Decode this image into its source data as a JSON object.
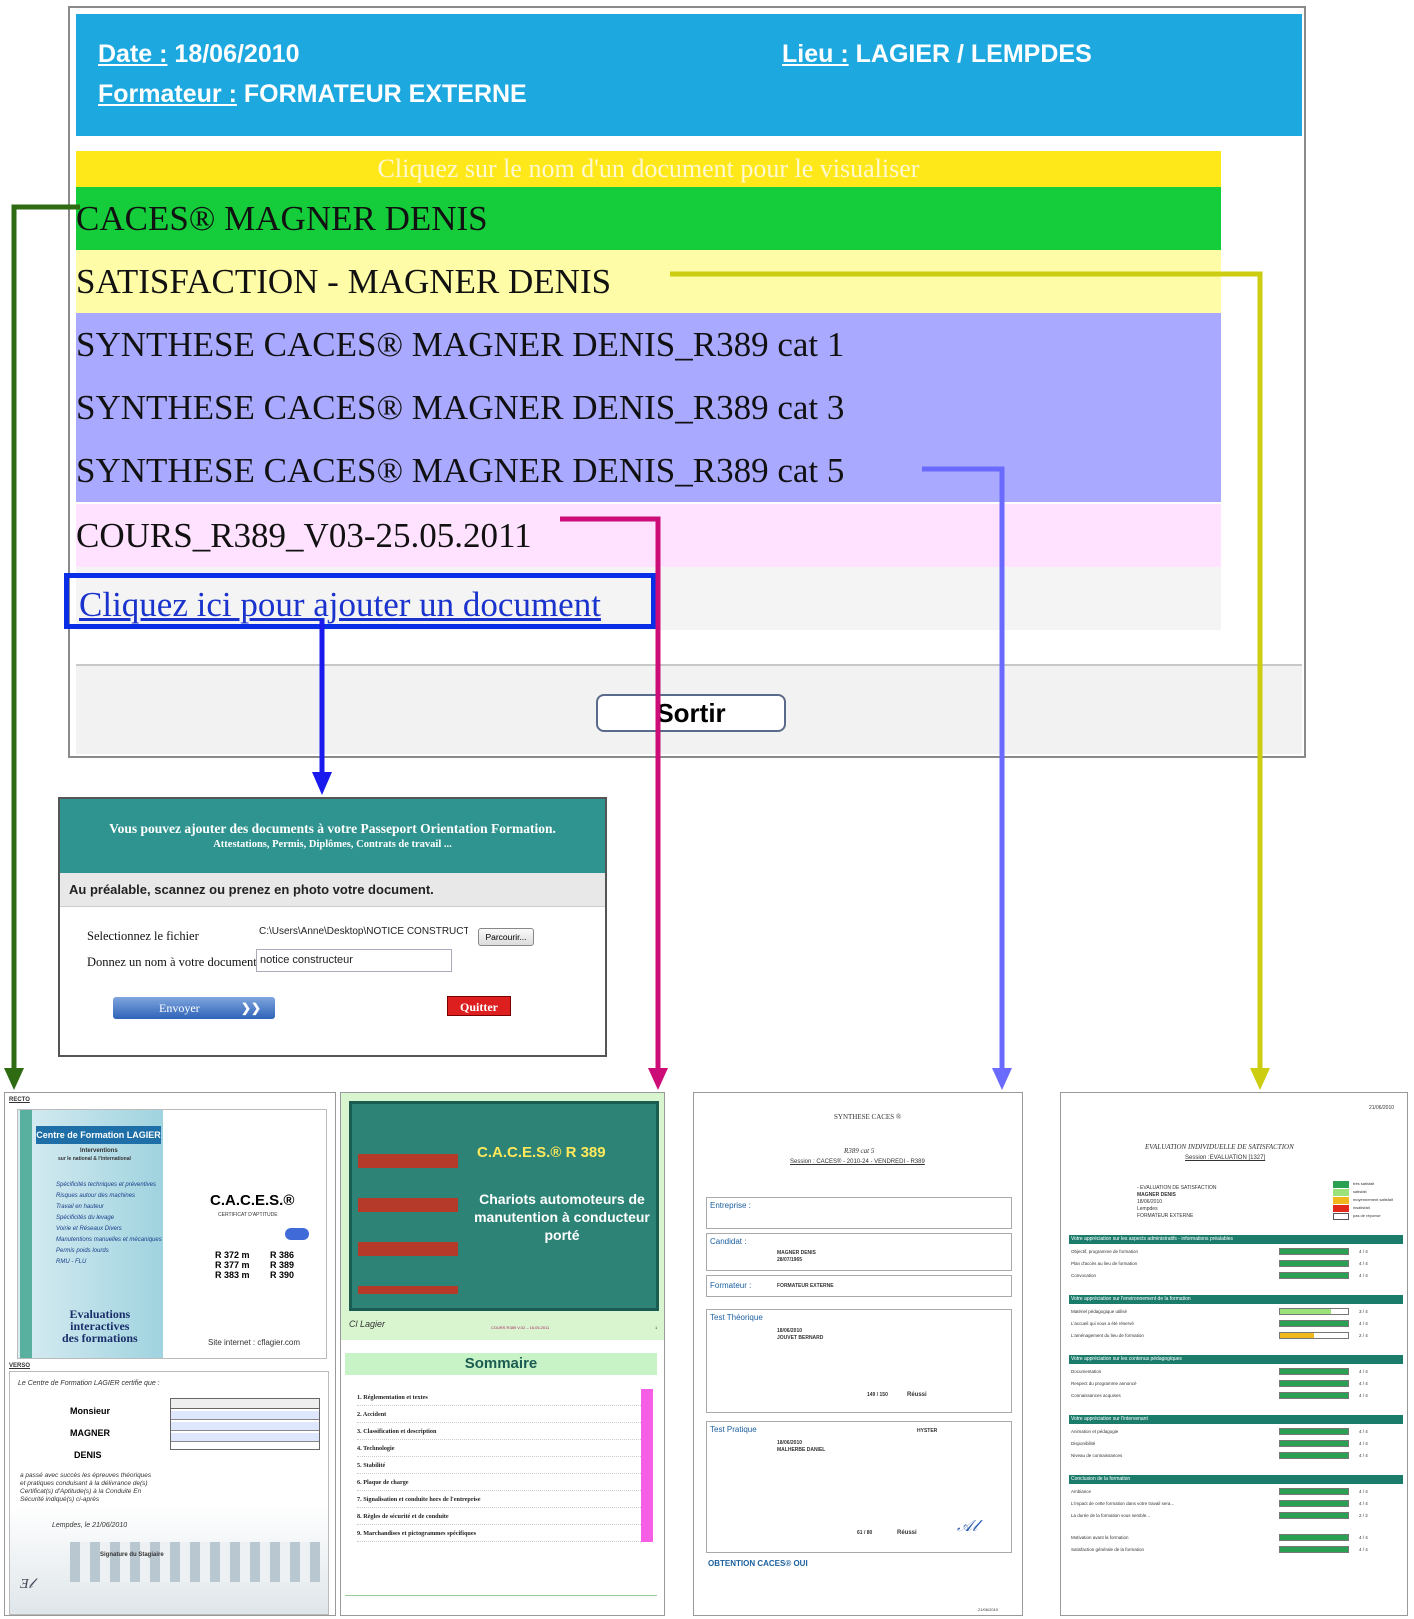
{
  "header": {
    "date_label": "Date :",
    "date_value": "18/06/2010",
    "lieu_label": "Lieu :",
    "lieu_value": "LAGIER / LEMPDES",
    "formateur_label": "Formateur :",
    "formateur_value": "FORMATEUR EXTERNE"
  },
  "instruction": "Cliquez sur le nom d'un document pour le visualiser",
  "documents": [
    {
      "label": "CACES® MAGNER DENIS",
      "color": "#15cc3a"
    },
    {
      "label": "SATISFACTION - MAGNER DENIS",
      "color": "#fffca8"
    },
    {
      "label": "SYNTHESE CACES® MAGNER DENIS_R389 cat 1",
      "color": "#a9a9ff"
    },
    {
      "label": "SYNTHESE CACES® MAGNER DENIS_R389 cat 3",
      "color": "#a9a9ff"
    },
    {
      "label": "SYNTHESE CACES® MAGNER DENIS_R389 cat 5",
      "color": "#a9a9ff"
    },
    {
      "label": "COURS_R389_V03-25.05.2011",
      "color": "#ffe2ff"
    }
  ],
  "add_document": "Cliquez ici pour ajouter un document",
  "sortir": "Sortir",
  "upload": {
    "title": "Vous pouvez ajouter des documents à votre Passeport Orientation Formation.",
    "subtitle": "Attestations, Permis, Diplômes, Contrats de travail ...",
    "instruction": "Au préalable, scannez ou prenez en photo votre document.",
    "file_label": "Selectionnez le fichier",
    "file_value": "C:\\Users\\Anne\\Desktop\\NOTICE CONSTRUCTEUR .doc",
    "browse": "Parcourir...",
    "name_label": "Donnez un nom à votre document",
    "name_value": "notice constructeur",
    "send": "Envoyer",
    "quit": "Quitter"
  },
  "thumb_caces": {
    "recto": "RECTO",
    "verso": "VERSO",
    "centre": "Centre de Formation LAGIER",
    "interventions": "Interventions",
    "national": "sur le national & l'international",
    "caces": "C.A.C.E.S.®",
    "eval1": "Evaluations",
    "eval2": "interactives",
    "eval3": "des formations",
    "site": "Site internet : cflagier.com",
    "certifie": "Le Centre de Formation LAGIER certifie que :",
    "monsieur": "Monsieur",
    "nom": "MAGNER",
    "prenom": "DENIS",
    "lempdes": "Lempdes, le 21/06/2010",
    "sig_stagiaire": "Signature du Stagiaire",
    "r_left": [
      "R 372 m",
      "R 377 m",
      "R 383 m"
    ],
    "r_right": [
      "R 386",
      "R 389",
      "R 390"
    ]
  },
  "thumb_cours": {
    "title": "C.A.C.E.S.® R 389",
    "subtitle": "Chariots automoteurs de manutention à conducteur porté",
    "footer_code": "COURS R389 V.02 – 16.05.2011",
    "page": "1",
    "sommaire": "Sommaire",
    "items": [
      "1.  Réglementation et textes",
      "2.  Accident",
      "3.  Classification et description",
      "4.  Technologie",
      "5.  Stabilité",
      "6.  Plaque de charge",
      "7.  Signalisation et conduite hors de l'entreprise",
      "8.  Règles de sécurité et de conduite",
      "9.  Marchandises et pictogrammes spécifiques"
    ]
  },
  "thumb_synthese": {
    "title": "SYNTHESE CACES ®",
    "cat": "R389 cat 5",
    "session": "Session : CACES® - 2010-24 - VENDREDI - R389",
    "entreprise": "Entreprise :",
    "candidat": "Candidat :",
    "candidat_nom": "MAGNER DENIS",
    "candidat_date": "28/07/1965",
    "formateur": "Formateur :",
    "formateur_nom": "FORMATEUR EXTERNE",
    "test_theorique": "Test Théorique",
    "theo_date": "18/06/2010",
    "theo_testeur": "JOUVET BERNARD",
    "theo_total": "149 / 150",
    "reussi": "Réussi",
    "test_pratique": "Test Pratique",
    "prat_date": "18/06/2010",
    "prat_testeur": "MALHERBE DANIEL",
    "prat_marque": "HYSTER",
    "prat_total": "61 / 80",
    "obtention": "OBTENTION CACES®   OUI",
    "footer_date": "21/06/2010"
  },
  "thumb_satisfaction": {
    "date": "21/06/2010",
    "title": "EVALUATION INDIVIDUELLE DE SATISFACTION",
    "session": "Session :EVALUATION [1327]",
    "questionnaire": "- EVALUATION DE SATISFACTION",
    "nom": "MAGNER DENIS",
    "date_formation": "18/06/2010",
    "lieu": "Lempdes",
    "formateur": "FORMATEUR EXTERNE",
    "legend": [
      "très satisfait",
      "satisfait",
      "moyennement satisfait",
      "insatisfait",
      "pas de réponse"
    ],
    "sections": [
      {
        "title": "Votre appréciation sur les aspects administratifs - informations préalables",
        "rows": [
          "Objectif, programme de formation",
          "Plan d'accès au lieu de formation",
          "Convocation"
        ],
        "scores": [
          "4 / 4",
          "4 / 4",
          "4 / 4"
        ],
        "levels": [
          1,
          1,
          1
        ]
      },
      {
        "title": "Votre appréciation sur l'environnement de la formation",
        "rows": [
          "Matériel pédagogique utilisé",
          "L'accueil qui vous a été réservé",
          "L'aménagement du lieu de formation"
        ],
        "scores": [
          "3 / 4",
          "4 / 4",
          "2 / 4"
        ],
        "levels": [
          0.75,
          1,
          0.5
        ]
      },
      {
        "title": "Votre appréciation sur les contenus pédagogiques",
        "rows": [
          "Documentation",
          "Respect du programme annoncé",
          "Connaissances acquises"
        ],
        "scores": [
          "4 / 4",
          "4 / 4",
          "4 / 4"
        ],
        "levels": [
          1,
          1,
          1
        ]
      },
      {
        "title": "Votre appréciation sur l'intervenant",
        "rows": [
          "Animation et pédagogie",
          "Disponibilité",
          "Niveau de connaissances"
        ],
        "scores": [
          "4 / 4",
          "4 / 4",
          "4 / 4"
        ],
        "levels": [
          1,
          1,
          1
        ]
      },
      {
        "title": "Conclusion de la formation",
        "rows": [
          "Ambiance",
          "L'impact de cette formation dans votre travail sera...",
          "La durée de la formation vous semble..."
        ],
        "scores": [
          "4 / 4",
          "4 / 4",
          "2 / 2"
        ],
        "levels": [
          1,
          1,
          1
        ]
      }
    ],
    "final_rows": [
      "Motivation avant la formation",
      "Satisfaction générale de la formation"
    ],
    "final_scores": [
      "4 / 4",
      "4 / 4"
    ]
  },
  "colors": {
    "header_bg": "#1da8e0",
    "arrow_caces": "#2e6b12",
    "arrow_satisfaction": "#cccc11",
    "arrow_synthese": "#6a6aff",
    "arrow_cours": "#cc0d78",
    "arrow_upload": "#1a1aee"
  }
}
